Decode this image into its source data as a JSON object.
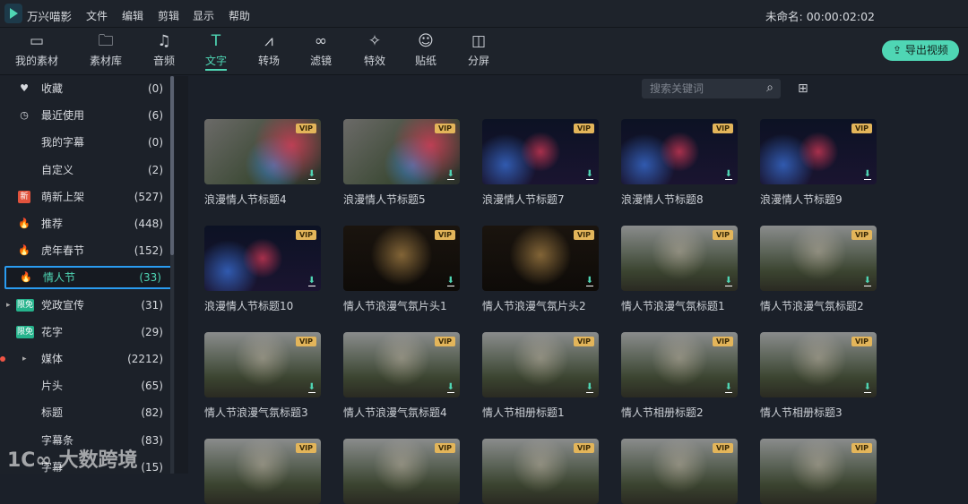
{
  "app": {
    "name": "万兴喵影",
    "project": "未命名: 00:00:02:02"
  },
  "menu": [
    "文件",
    "编辑",
    "剪辑",
    "显示",
    "帮助"
  ],
  "tools": [
    {
      "label": "我的素材",
      "icon": "▭"
    },
    {
      "label": "素材库",
      "icon": "🗀"
    },
    {
      "label": "音频",
      "icon": "♫"
    },
    {
      "label": "文字",
      "icon": "T",
      "active": true,
      "dot": true
    },
    {
      "label": "转场",
      "icon": "⩘",
      "dot": true
    },
    {
      "label": "滤镜",
      "icon": "∞"
    },
    {
      "label": "特效",
      "icon": "✧",
      "dot": true
    },
    {
      "label": "贴纸",
      "icon": "☺",
      "dot": true
    },
    {
      "label": "分屏",
      "icon": "◫"
    }
  ],
  "export_label": "导出视频",
  "search": {
    "placeholder": "搜索关键词"
  },
  "categories": [
    {
      "label": "收藏",
      "count": "(0)",
      "icon": "♥"
    },
    {
      "label": "最近使用",
      "count": "(6)",
      "icon": "◷"
    },
    {
      "label": "我的字幕",
      "count": "(0)"
    },
    {
      "label": "自定义",
      "count": "(2)"
    },
    {
      "label": "萌新上架",
      "count": "(527)",
      "badge": "新"
    },
    {
      "label": "推荐",
      "count": "(448)",
      "fire": true
    },
    {
      "label": "虎年春节",
      "count": "(152)",
      "fire": true
    },
    {
      "label": "情人节",
      "count": "(33)",
      "fire": true,
      "selected": true
    },
    {
      "label": "党政宣传",
      "count": "(31)",
      "badge": "限免",
      "free": true,
      "expand": true
    },
    {
      "label": "花字",
      "count": "(29)",
      "badge": "限免",
      "free": true
    },
    {
      "label": "媒体",
      "count": "(2212)",
      "expand": true,
      "dot": true
    },
    {
      "label": "片头",
      "count": "(65)"
    },
    {
      "label": "标题",
      "count": "(82)"
    },
    {
      "label": "字幕条",
      "count": "(83)"
    },
    {
      "label": "字幕",
      "count": "(15)"
    }
  ],
  "vip_label": "VIP",
  "items": [
    {
      "title": "浪漫情人节标题4",
      "style": "hearts"
    },
    {
      "title": "浪漫情人节标题5",
      "style": "hearts"
    },
    {
      "title": "浪漫情人节标题7",
      "style": "dark"
    },
    {
      "title": "浪漫情人节标题8",
      "style": "dark"
    },
    {
      "title": "浪漫情人节标题9",
      "style": "dark"
    },
    {
      "title": "浪漫情人节标题10",
      "style": "dark"
    },
    {
      "title": "情人节浪漫气氛片头1",
      "style": "gold"
    },
    {
      "title": "情人节浪漫气氛片头2",
      "style": "gold"
    },
    {
      "title": "情人节浪漫气氛标题1",
      "style": "photo"
    },
    {
      "title": "情人节浪漫气氛标题2",
      "style": "photo"
    },
    {
      "title": "情人节浪漫气氛标题3",
      "style": "photo"
    },
    {
      "title": "情人节浪漫气氛标题4",
      "style": "photo"
    },
    {
      "title": "情人节相册标题1",
      "style": "photo"
    },
    {
      "title": "情人节相册标题2",
      "style": "photo"
    },
    {
      "title": "情人节相册标题3",
      "style": "photo"
    },
    {
      "title": "",
      "style": "photo"
    },
    {
      "title": "",
      "style": "photo"
    },
    {
      "title": "",
      "style": "photo"
    },
    {
      "title": "",
      "style": "photo"
    },
    {
      "title": "",
      "style": "photo"
    }
  ],
  "watermark": "1C∞ 大数跨境"
}
